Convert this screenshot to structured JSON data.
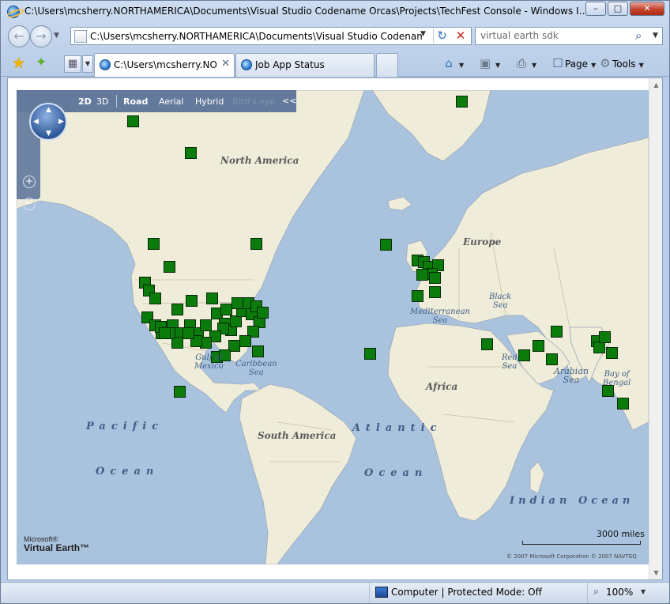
{
  "window": {
    "title": "C:\\Users\\mcsherry.NORTHAMERICA\\Documents\\Visual Studio Codename Orcas\\Projects\\TechFest Console - Windows Internet Expl...",
    "minimize_icon": "minimize-icon",
    "maximize_icon": "maximize-icon",
    "close_icon": "close-icon"
  },
  "address_bar": {
    "url": "C:\\Users\\mcsherry.NORTHAMERICA\\Documents\\Visual Studio Codename Or",
    "back_icon": "back-arrow-icon",
    "forward_icon": "forward-arrow-icon",
    "refresh_icon": "refresh-icon",
    "stop_icon": "stop-icon"
  },
  "search": {
    "value": "virtual earth sdk",
    "icon": "search-icon"
  },
  "tabs": [
    {
      "label": "C:\\Users\\mcsherry.NO...",
      "active": true
    },
    {
      "label": "Job App Status",
      "active": false
    }
  ],
  "command_bar": {
    "page_label": "Page",
    "tools_label": "Tools"
  },
  "map": {
    "nav": {
      "view_2d": "2D",
      "view_3d": "3D",
      "road": "Road",
      "aerial": "Aerial",
      "hybrid": "Hybrid",
      "birds_eye": "Bird's eye",
      "collapse": "<<"
    },
    "labels": {
      "north_america": "North America",
      "south_america": "South America",
      "europe": "Europe",
      "africa": "Africa",
      "pacific_1": "Pacific",
      "pacific_2": "Ocean",
      "atlantic_1": "Atlantic",
      "atlantic_2": "Ocean",
      "indian": "Indian Ocean",
      "gulf_mexico": "Gulf of\nMexico",
      "caribbean": "Caribbean\nSea",
      "mediterranean": "Mediterranean\nSea",
      "black_sea": "Black\nSea",
      "red_sea": "Red\nSea",
      "arabian_sea": "Arabian\nSea",
      "bay_bengal": "Bay of\nBengal"
    },
    "logo_top": "Microsoft®",
    "logo_bottom": "Virtual Earth™",
    "scale": "3000 miles",
    "copyright": "© 2007 Microsoft Corporation    © 2007 NAVTEQ",
    "marker_color": "#0b7b0b",
    "land_color": "#efecd9",
    "water_color": "#a9c3de"
  },
  "status_bar": {
    "zone": "Computer | Protected Mode: Off",
    "zoom": "100%"
  }
}
